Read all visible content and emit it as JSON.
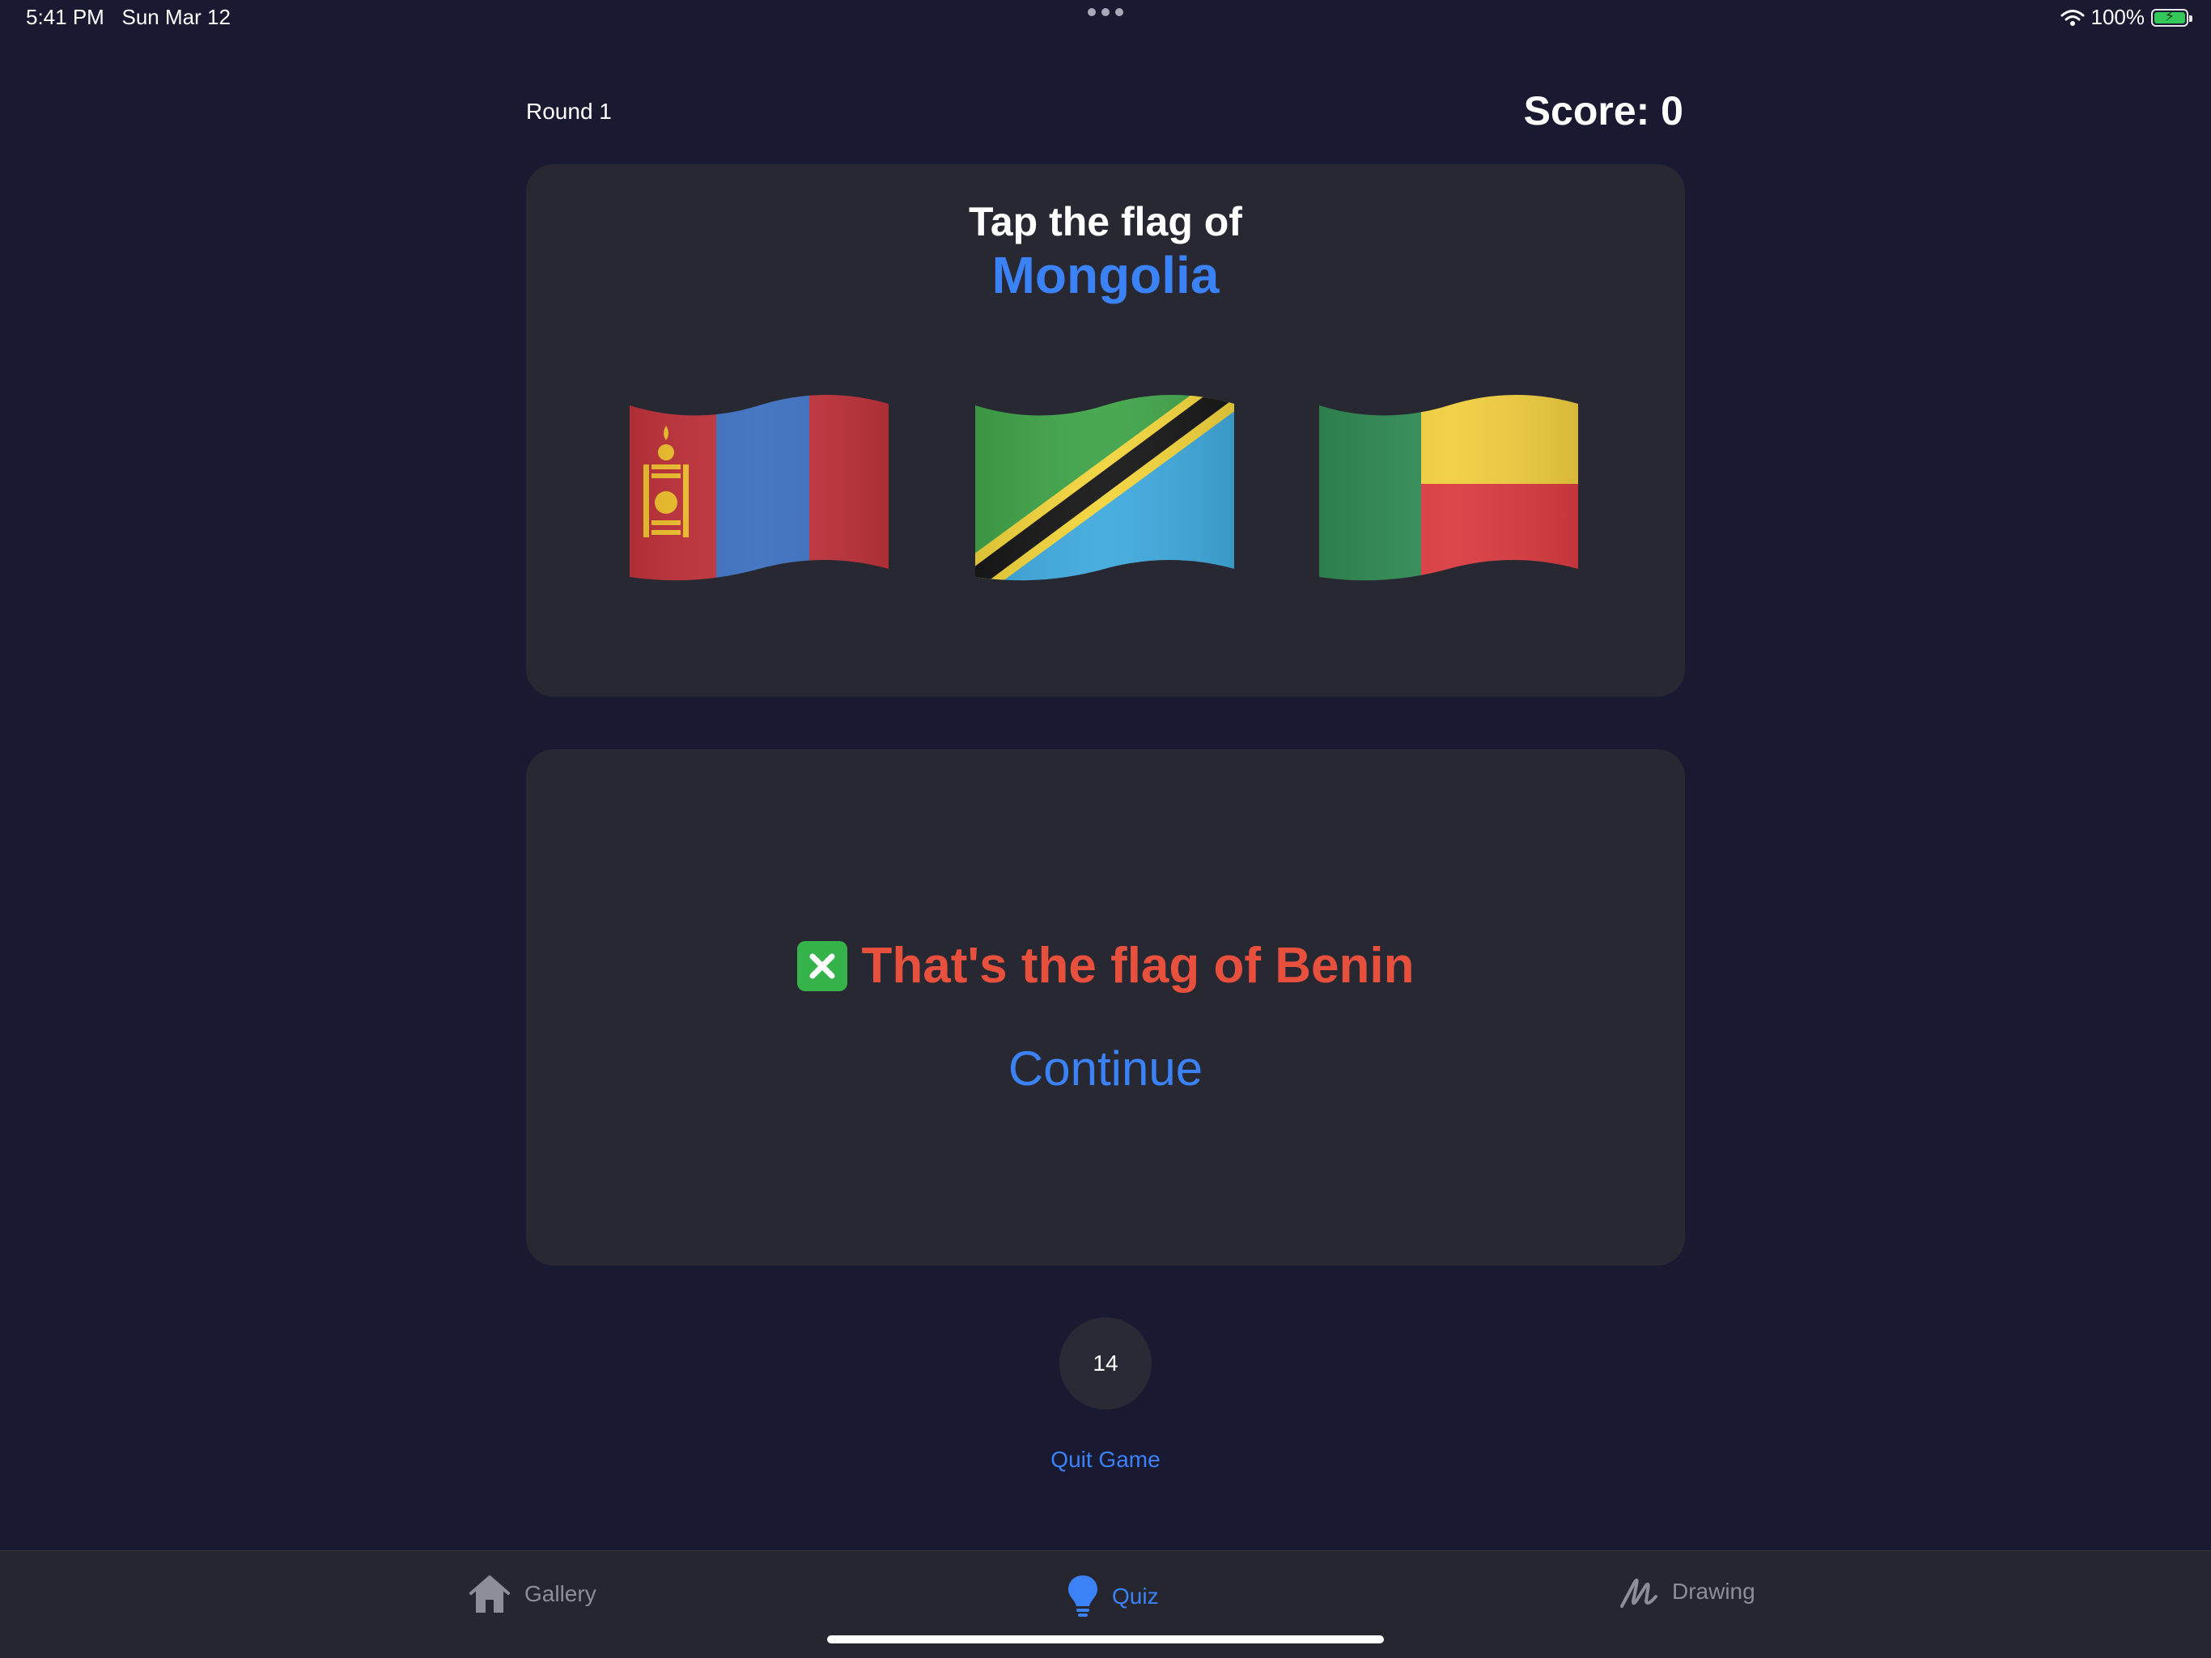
{
  "status_bar": {
    "time": "5:41 PM",
    "date": "Sun Mar 12",
    "battery": "100%",
    "battery_level": 1.0
  },
  "header": {
    "round": "Round 1",
    "score": "Score: 0"
  },
  "question": {
    "prompt": "Tap the flag of",
    "country": "Mongolia",
    "flags": [
      {
        "country": "Mongolia",
        "icon": "mongolia-flag-icon"
      },
      {
        "country": "Tanzania",
        "icon": "tanzania-flag-icon"
      },
      {
        "country": "Benin",
        "icon": "benin-flag-icon"
      }
    ]
  },
  "feedback": {
    "message": "That's the flag of Benin",
    "icon": "cross-mark-icon",
    "continue_label": "Continue"
  },
  "timer": {
    "seconds": "14"
  },
  "quit_label": "Quit Game",
  "tab_bar": {
    "tabs": [
      {
        "label": "Gallery",
        "icon": "house-icon",
        "active": false
      },
      {
        "label": "Quiz",
        "icon": "lightbulb-icon",
        "active": true
      },
      {
        "label": "Drawing",
        "icon": "scribble-icon",
        "active": false
      }
    ]
  },
  "colors": {
    "background": "#191932",
    "card": "#282832",
    "accent": "#3b82f6",
    "error": "#e8503e",
    "success": "#35b24a"
  }
}
